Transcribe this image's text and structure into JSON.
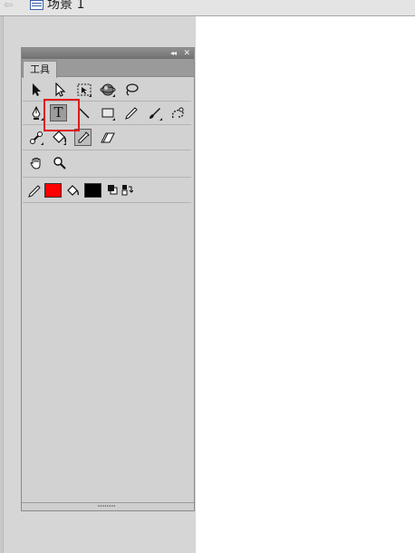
{
  "breadcrumb": {
    "scene_label": "场景 1"
  },
  "panel": {
    "tab_label": "工具",
    "collapse_glyph": "◂◂",
    "close_glyph": "✕"
  },
  "tools": {
    "row1": [
      "selection-arrow",
      "subselection-arrow",
      "free-transform",
      "3d-rotation",
      "lasso"
    ],
    "row2": [
      "pen",
      "text",
      "line",
      "rectangle",
      "pencil",
      "brush",
      "deco"
    ],
    "row3": [
      "bone",
      "paint-bucket",
      "eyedropper",
      "eraser"
    ],
    "row4": [
      "hand",
      "zoom"
    ],
    "row5": [
      "stroke-color",
      "fill-color",
      "black-white",
      "swap-colors"
    ],
    "selected_tool": "text",
    "text_tool_glyph": "T"
  },
  "colors": {
    "stroke": "#ff0000",
    "fill": "#000000",
    "highlight": "#e0191b"
  }
}
